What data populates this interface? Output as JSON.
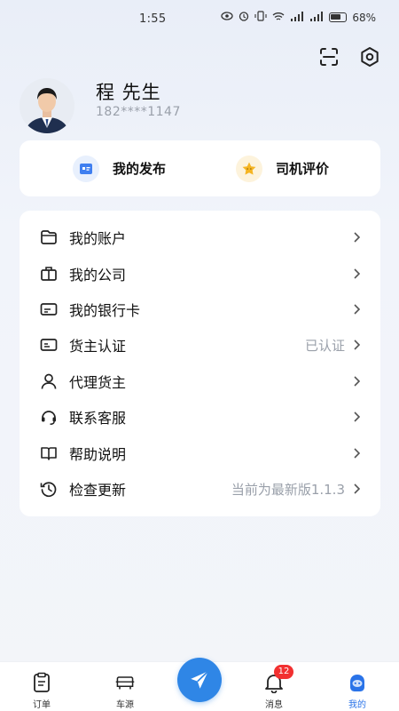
{
  "status_bar": {
    "time": "1:55",
    "battery": "68%"
  },
  "header": {
    "scan_icon": "scan-icon",
    "settings_icon": "settings-icon"
  },
  "profile": {
    "name": "程 先生",
    "phone": "182****1147"
  },
  "quick_actions": [
    {
      "label": "我的发布",
      "icon": "publish-icon"
    },
    {
      "label": "司机评价",
      "icon": "star-icon"
    }
  ],
  "menu": [
    {
      "label": "我的账户",
      "value": "",
      "icon": "wallet-icon"
    },
    {
      "label": "我的公司",
      "value": "",
      "icon": "company-icon"
    },
    {
      "label": "我的银行卡",
      "value": "",
      "icon": "bank-card-icon"
    },
    {
      "label": "货主认证",
      "value": "已认证",
      "icon": "id-card-icon"
    },
    {
      "label": "代理货主",
      "value": "",
      "icon": "person-icon"
    },
    {
      "label": "联系客服",
      "value": "",
      "icon": "headset-icon"
    },
    {
      "label": "帮助说明",
      "value": "",
      "icon": "book-icon"
    },
    {
      "label": "检查更新",
      "value": "当前为最新版1.1.3",
      "icon": "history-icon"
    }
  ],
  "tabbar": {
    "tabs": [
      {
        "label": "订单",
        "icon": "order-icon"
      },
      {
        "label": "车源",
        "icon": "truck-icon"
      },
      {
        "label": "消息",
        "icon": "bell-icon",
        "badge": "12"
      },
      {
        "label": "我的",
        "icon": "profile-icon"
      }
    ],
    "active_color": "#2a73e8",
    "fab_color": "#2f86e6"
  }
}
